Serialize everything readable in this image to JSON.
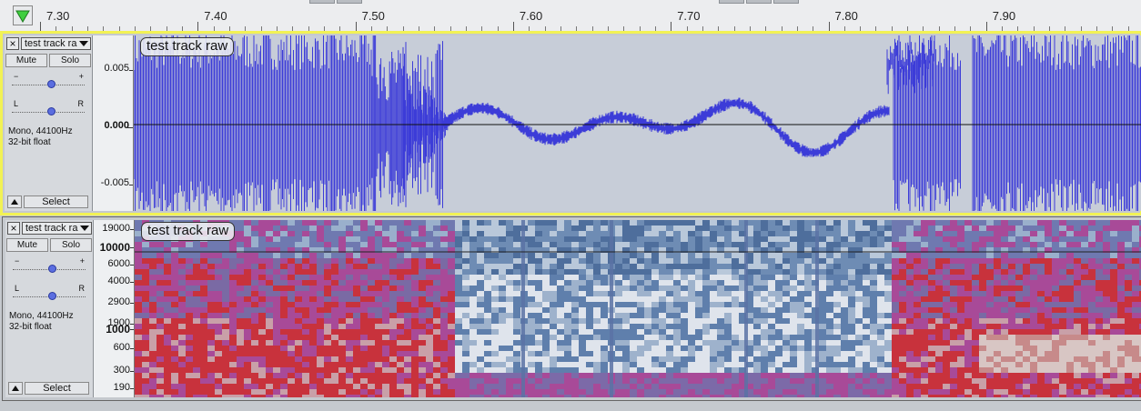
{
  "timeline": {
    "ticks": [
      "7.30",
      "7.40",
      "7.50",
      "7.60",
      "7.70",
      "7.80",
      "7.90"
    ]
  },
  "tracks": [
    {
      "type": "waveform",
      "name": "test track ra",
      "label": "test track raw",
      "mute_label": "Mute",
      "solo_label": "Solo",
      "gain_minus": "−",
      "gain_plus": "+",
      "pan_left": "L",
      "pan_right": "R",
      "format_line1": "Mono, 44100Hz",
      "format_line2": "32-bit float",
      "select_label": "Select",
      "ruler": [
        "0.005",
        "0.000",
        "-0.005"
      ]
    },
    {
      "type": "spectrogram",
      "name": "test track ra",
      "label": "test track raw",
      "mute_label": "Mute",
      "solo_label": "Solo",
      "gain_minus": "−",
      "gain_plus": "+",
      "pan_left": "L",
      "pan_right": "R",
      "format_line1": "Mono, 44100Hz",
      "format_line2": "32-bit float",
      "select_label": "Select",
      "ruler": [
        "19000",
        "10000",
        "6000",
        "4000",
        "2900",
        "1900",
        "1000",
        "600",
        "300",
        "190"
      ],
      "ruler_bold": [
        "10000",
        "1000"
      ]
    }
  ],
  "colors": {
    "waveform": "#3c3cd8",
    "waveform_bg": "#c7cdd8",
    "selection_border": "#f2f254",
    "spectro_hot": "#c8323c",
    "spectro_mid": "#a84a98",
    "spectro_cold": "#4c6c9c"
  },
  "icons": {
    "play_region": "green-down-triangle-icon",
    "close": "close-icon",
    "menu": "chevron-down-icon",
    "collapse": "collapse-up-icon"
  }
}
